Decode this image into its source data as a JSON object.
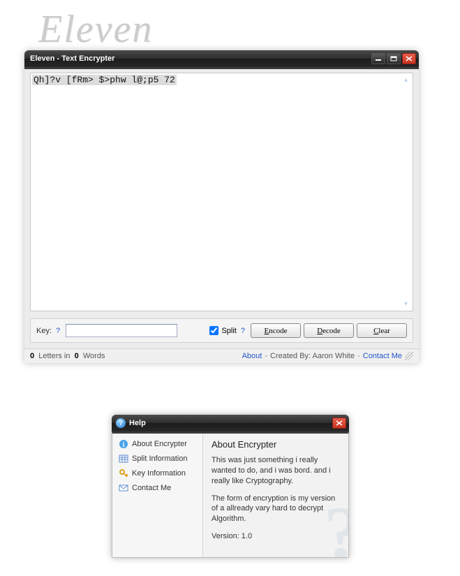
{
  "logo": "Eleven",
  "window": {
    "title": "Eleven - Text Encrypter",
    "text_content": "Qh]?v [fRm> $>phw l@;p5 72",
    "key_label": "Key:",
    "key_value": "",
    "split_label": "Split",
    "encode_label": "Encode",
    "decode_label": "Decode",
    "clear_label": "Clear",
    "split_checked": true
  },
  "status": {
    "letters_count": "0",
    "letters_label": "Letters in",
    "words_count": "0",
    "words_label": "Words",
    "about_link": "About",
    "created_by": "Created By: Aaron White",
    "contact_link": "Contact Me"
  },
  "help": {
    "title": "Help",
    "nav": {
      "about": "About Encrypter",
      "split": "Split Information",
      "key": "Key Information",
      "contact": "Contact Me"
    },
    "content": {
      "heading": "About Encrypter",
      "p1": "This was just something i really wanted to do, and i was bord. and i really like Cryptography.",
      "p2": "The form of encryption is my version of a allready vary hard to decrypt Algorithm.",
      "version": "Version: 1.0"
    }
  }
}
